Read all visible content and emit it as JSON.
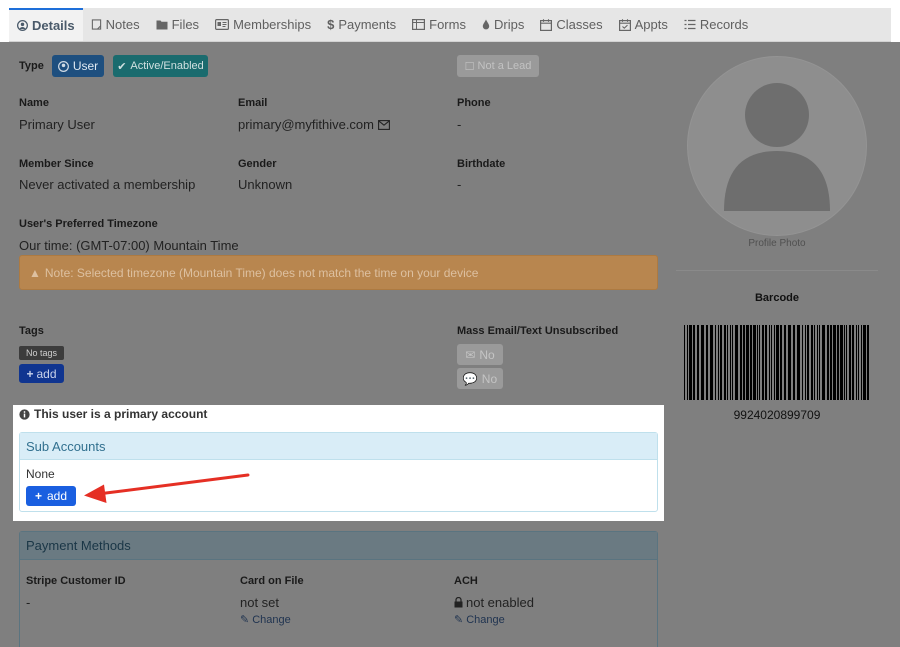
{
  "tabs": [
    {
      "label": "Details",
      "icon": "user-circle-icon"
    },
    {
      "label": "Notes",
      "icon": "note-icon"
    },
    {
      "label": "Files",
      "icon": "folder-icon"
    },
    {
      "label": "Memberships",
      "icon": "id-card-icon"
    },
    {
      "label": "Payments",
      "icon": "dollar-icon"
    },
    {
      "label": "Forms",
      "icon": "form-icon"
    },
    {
      "label": "Drips",
      "icon": "drop-icon"
    },
    {
      "label": "Classes",
      "icon": "calendar-icon"
    },
    {
      "label": "Appts",
      "icon": "calendar-check-icon"
    },
    {
      "label": "Records",
      "icon": "list-icon"
    }
  ],
  "type": {
    "label": "Type",
    "user_badge": "User",
    "status_badge": "Active/Enabled",
    "lead_button": "Not a Lead"
  },
  "fields": {
    "name": {
      "label": "Name",
      "value": "Primary User"
    },
    "email": {
      "label": "Email",
      "value": "primary@myfithive.com"
    },
    "phone": {
      "label": "Phone",
      "value": "-"
    },
    "member_since": {
      "label": "Member Since",
      "value": "Never activated a membership"
    },
    "gender": {
      "label": "Gender",
      "value": "Unknown"
    },
    "birthdate": {
      "label": "Birthdate",
      "value": "-"
    },
    "timezone": {
      "label": "User's Preferred Timezone",
      "value": "Our time: (GMT-07:00) Mountain Time"
    }
  },
  "timezone_warning": "Note: Selected timezone (Mountain Time) does not match the time on your device",
  "tags": {
    "label": "Tags",
    "empty_badge": "No tags",
    "add_button": "add"
  },
  "unsubscribe": {
    "label": "Mass Email/Text Unsubscribed",
    "email_value": "No",
    "text_value": "No"
  },
  "primary_notice": "This user is a primary account",
  "sub_accounts": {
    "title": "Sub Accounts",
    "value": "None",
    "add_button": "add"
  },
  "payment_methods": {
    "title": "Payment Methods",
    "stripe": {
      "label": "Stripe Customer ID",
      "value": "-"
    },
    "card": {
      "label": "Card on File",
      "value": "not set",
      "change": "Change"
    },
    "ach": {
      "label": "ACH",
      "value": "not enabled",
      "change": "Change"
    }
  },
  "profile": {
    "photo_caption": "Profile Photo",
    "barcode_label": "Barcode",
    "barcode_number": "9924020899709"
  },
  "colors": {
    "accent_blue": "#1a5fe0",
    "arrow_red": "#e52f24",
    "dim_overlay": "#7f7f7f",
    "panel_head": "#d9edf7"
  }
}
